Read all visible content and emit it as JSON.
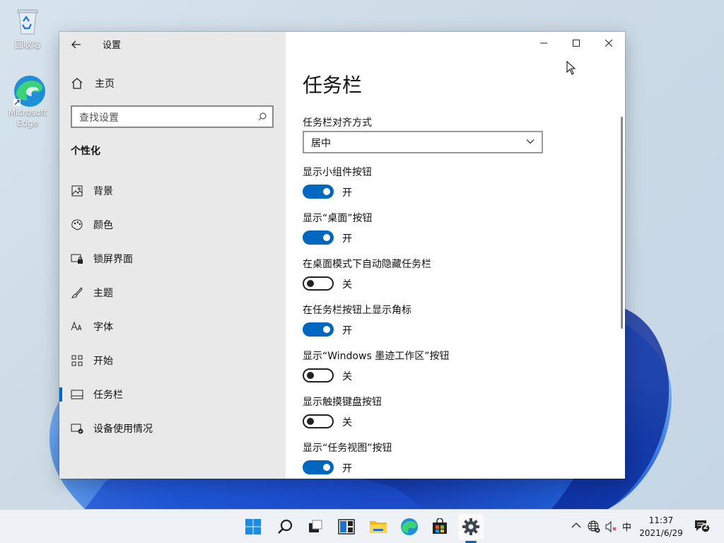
{
  "desktop": {
    "icons": [
      {
        "label": "回收站"
      },
      {
        "label": "Microsoft Edge"
      }
    ]
  },
  "window": {
    "title": "设置",
    "sidebar": {
      "home_label": "主页",
      "search_placeholder": "查找设置",
      "group_title": "个性化",
      "items": [
        {
          "label": "背景",
          "icon": "picture-icon"
        },
        {
          "label": "颜色",
          "icon": "palette-icon"
        },
        {
          "label": "锁屏界面",
          "icon": "lock-screen-icon"
        },
        {
          "label": "主题",
          "icon": "brush-icon"
        },
        {
          "label": "字体",
          "icon": "font-icon"
        },
        {
          "label": "开始",
          "icon": "start-grid-icon"
        },
        {
          "label": "任务栏",
          "icon": "taskbar-icon",
          "active": true
        },
        {
          "label": "设备使用情况",
          "icon": "device-usage-icon"
        }
      ]
    },
    "main": {
      "page_title": "任务栏",
      "alignment_label": "任务栏对齐方式",
      "alignment_value": "居中",
      "toggles": [
        {
          "label": "显示小组件按钮",
          "state": "开",
          "on": true
        },
        {
          "label": "显示“桌面”按钮",
          "state": "开",
          "on": true
        },
        {
          "label": "在桌面模式下自动隐藏任务栏",
          "state": "关",
          "on": false
        },
        {
          "label": "在任务栏按钮上显示角标",
          "state": "开",
          "on": true
        },
        {
          "label": "显示“Windows 墨迹工作区”按钮",
          "state": "关",
          "on": false
        },
        {
          "label": "显示触摸键盘按钮",
          "state": "关",
          "on": false
        },
        {
          "label": "显示“任务视图”按钮",
          "state": "开",
          "on": true
        }
      ]
    }
  },
  "taskbar": {
    "ime": "中",
    "time": "11:37",
    "date": "2021/6/29",
    "notification_count": "2"
  },
  "colors": {
    "accent": "#0067c0"
  }
}
